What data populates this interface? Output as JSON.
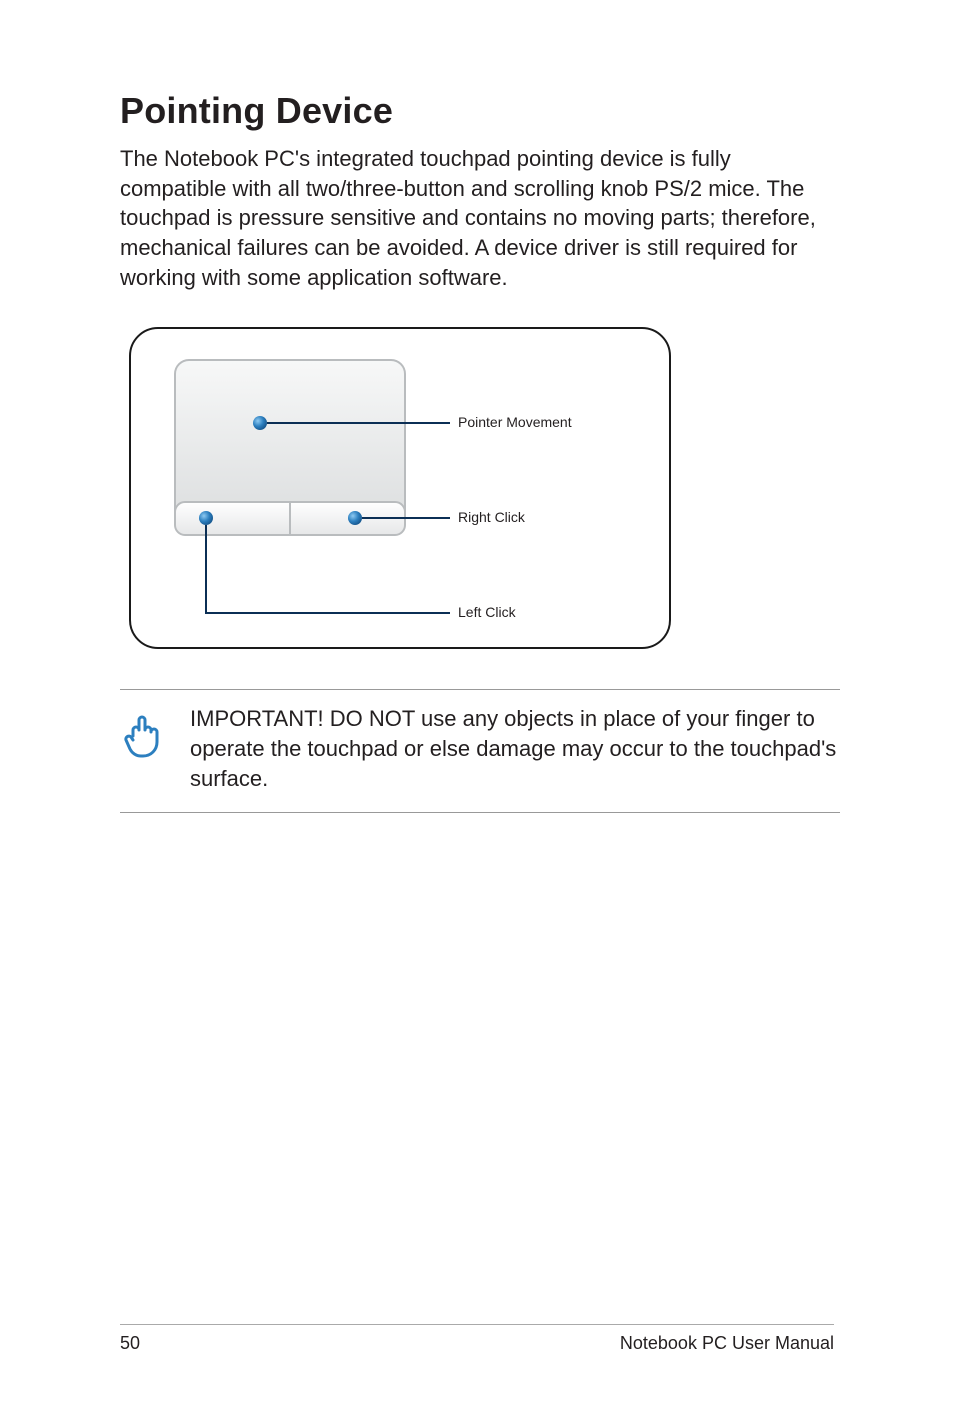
{
  "title": "Pointing Device",
  "body": "The Notebook PC's integrated touchpad pointing device is fully compatible with all two/three-button and scrolling knob PS/2 mice. The touchpad is pressure sensitive and contains no moving parts; therefore, mechanical failures can be avoided. A device driver is still required for working with some application software.",
  "diagram": {
    "labels": {
      "pointer_movement": "Pointer Movement",
      "right_click": "Right Click",
      "left_click": "Left Click"
    }
  },
  "important_note": "IMPORTANT! DO NOT use any objects in place of your finger to operate the touchpad or else damage may occur to the touchpad's surface.",
  "footer": {
    "page_number": "50",
    "manual_title": "Notebook PC User Manual"
  }
}
